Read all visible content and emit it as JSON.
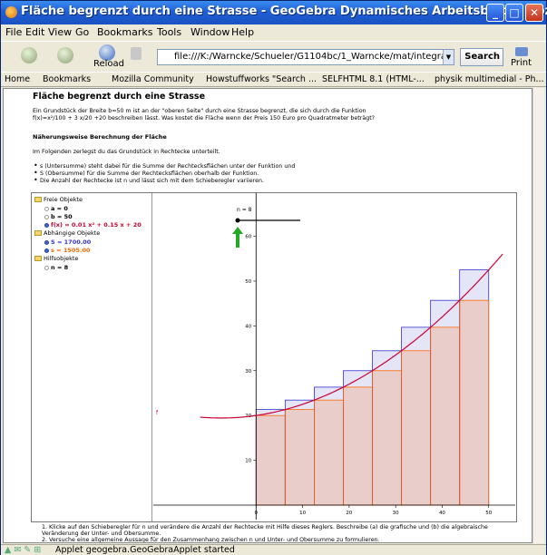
{
  "window": {
    "title": "Fläche begrenzt durch eine Strasse - GeoGebra Dynamisches Arbeitsblatt - Mozilla"
  },
  "menu": [
    "File",
    "Edit",
    "View",
    "Go",
    "Bookmarks",
    "Tools",
    "Window",
    "Help"
  ],
  "toolbar": {
    "reload_label": "Reload",
    "url": "file:///K:/Warncke/Schueler/G1104bc/1_Warncke/mat/integral_f.htm",
    "search_label": "Search",
    "print_label": "Print"
  },
  "bookmarks": [
    "Home",
    "Bookmarks",
    "Mozilla Community",
    "Howstuffworks \"Search ...",
    "SELFHTML 8.1 (HTML-...",
    "physik multimedial - Ph..."
  ],
  "page": {
    "title": "Fläche begrenzt durch eine Strasse",
    "intro_line1": "Ein Grundstück der Breite b=50 m ist an der \"oberen Seite\" durch eine Strasse begrenzt, die sich durch die Funktion",
    "intro_line2": "f(x)=x²/100 + 3 x/20 +20 beschreiben lässt. Was kostet die Fläche wenn der Preis 150 Euro pro Quadratmeter beträgt?",
    "section_heading": "Näherungsweise Berechnung der Fläche",
    "section_intro": "Im Folgenden zerlegst du das Grundstück in Rechtecke unterteilt.",
    "bullets": [
      "s (Untersumme) steht dabei für die Summe der Rechtecksflächen unter der Funktion und",
      "S (Obersumme) für die Summe der Rechtecksflächen oberhalb der Funktion.",
      "Die Anzahl der Rechtecke ist n und lässt sich mit dem Schieberegler variieren."
    ],
    "footer_items": [
      "1.  Klicke auf den Schieberegler für n und verändere die Anzahl der Rechtecke mit Hilfe dieses Reglers. Beschreibe (a) die grafische und (b) die algebraische",
      "     Veränderung der Unter- und Obersumme.",
      "2.  Versuche eine allgemeine Aussage für den Zusammenhang zwischen n und Unter- und Obersumme zu formulieren."
    ]
  },
  "algebra_view": {
    "free_header": "Freie Objekte",
    "free_items": [
      {
        "text": "a = 0",
        "color": "#000000"
      },
      {
        "text": "b = 50",
        "color": "#000000"
      },
      {
        "text": "f(x) = 0.01 x² + 0.15 x + 20",
        "color": "#CC0033"
      }
    ],
    "dependent_header": "Abhängige Objekte",
    "dependent_items": [
      {
        "text": "S = 1700.00",
        "color": "#3333CC"
      },
      {
        "text": "s = 1505.00",
        "color": "#FF6600"
      }
    ],
    "aux_header": "Hilfsobjekte",
    "aux_items": [
      {
        "text": "n = 8",
        "color": "#000000"
      }
    ]
  },
  "graph": {
    "slider_label": "n = 8",
    "x_ticks": [
      "0",
      "10",
      "20",
      "30",
      "40",
      "50"
    ],
    "y_ticks": [
      "10",
      "20",
      "30",
      "40",
      "50",
      "60"
    ],
    "curve_start_label": "f",
    "colors": {
      "curve": "#CC0033",
      "upper": "#3333CC",
      "lower": "#FF6600",
      "arrow": "#22AA22"
    }
  },
  "chart_data": {
    "type": "bar",
    "function": "f(x) = 0.01 x² + 0.15 x + 20",
    "n": 8,
    "interval": [
      0,
      50
    ],
    "x_edges": [
      0,
      6.25,
      12.5,
      18.75,
      25,
      31.25,
      37.5,
      43.75,
      50
    ],
    "upper_sum_heights": [
      21.33,
      23.44,
      26.33,
      30.0,
      34.45,
      39.69,
      45.7,
      52.5
    ],
    "lower_sum_heights": [
      20.0,
      21.33,
      23.44,
      26.33,
      30.0,
      34.45,
      39.69,
      45.7
    ],
    "upper_sum": 1700.0,
    "lower_sum": 1505.0,
    "xlim": [
      -10,
      52
    ],
    "ylim": [
      0,
      68
    ]
  },
  "status": {
    "text": "Applet geogebra.GeoGebraApplet started"
  }
}
